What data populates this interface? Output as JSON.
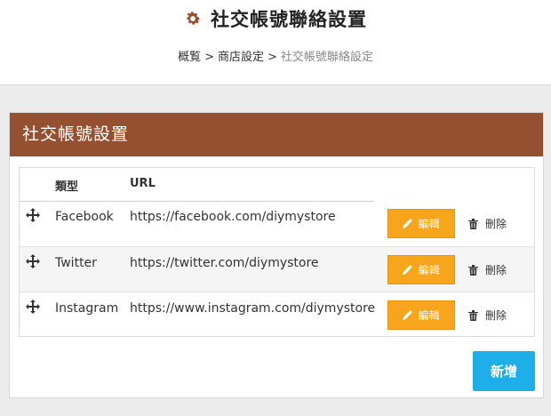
{
  "header": {
    "title": "社交帳號聯絡設置",
    "icon": "gear-icon",
    "icon_color": "#955031"
  },
  "breadcrumb": {
    "items": [
      "概覧",
      "商店設定",
      "社交帳號聯絡設定"
    ],
    "separator": ">"
  },
  "panel": {
    "title": "社交帳號設置",
    "header_color": "#955031"
  },
  "table": {
    "columns": [
      "類型",
      "URL"
    ],
    "rows": [
      {
        "type": "Facebook",
        "url": "https://facebook.com/diymystore",
        "edit_label": "編輯",
        "delete_label": "刪除"
      },
      {
        "type": "Twitter",
        "url": "https://twitter.com/diymystore",
        "edit_label": "編輯",
        "delete_label": "刪除"
      },
      {
        "type": "Instagram",
        "url": "https://www.instagram.com/diymystore",
        "edit_label": "編輯",
        "delete_label": "刪除"
      }
    ]
  },
  "actions": {
    "add_label": "新增",
    "edit_color": "#f7a51d",
    "add_color": "#1eaee8"
  }
}
